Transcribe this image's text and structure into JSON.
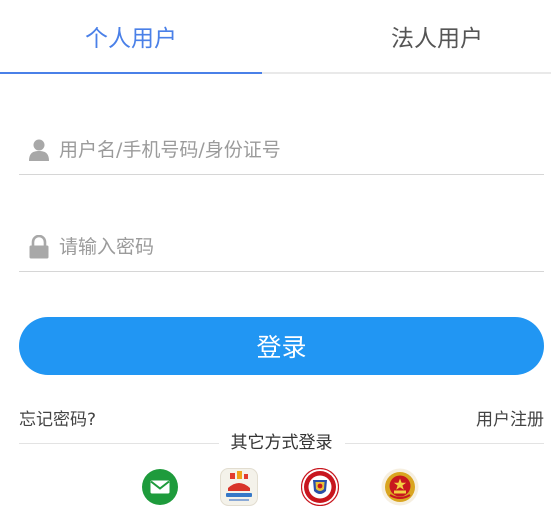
{
  "tabs": [
    {
      "label": "个人用户",
      "active": true
    },
    {
      "label": "法人用户",
      "active": false
    }
  ],
  "form": {
    "username_placeholder": "用户名/手机号码/身份证号",
    "username_value": "",
    "password_placeholder": "请输入密码",
    "password_value": "",
    "login_label": "登录"
  },
  "links": {
    "forgot_password": "忘记密码?",
    "register": "用户注册"
  },
  "other_login": {
    "title": "其它方式登录",
    "icons": [
      "sms-envelope-icon",
      "app-icon",
      "police-badge-icon",
      "national-emblem-icon"
    ]
  },
  "colors": {
    "accent": "#4a80e8",
    "button": "#2196f3",
    "sms_green": "#1e9b3c",
    "badge_red": "#c8161e",
    "emblem_gold": "#d9a520"
  }
}
